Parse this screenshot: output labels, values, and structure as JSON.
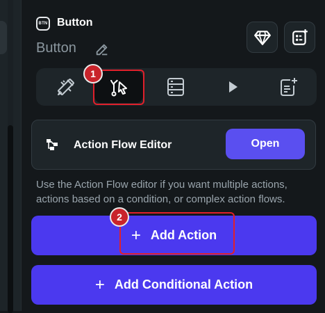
{
  "header": {
    "type_badge": "BTN",
    "type_label": "Button",
    "widget_name": "Button"
  },
  "icons": {
    "edit": "pencil-icon",
    "diamond": "diamond-icon",
    "add_component": "add-component-icon",
    "tabs": [
      "properties-icon",
      "actions-flow-icon",
      "backend-query-icon",
      "animation-play-icon",
      "add-to-list-icon"
    ]
  },
  "tabs": {
    "active_index": 1
  },
  "annotations": {
    "step1": "1",
    "step2": "2",
    "highlight_color": "#e0202b"
  },
  "flow_card": {
    "title": "Action Flow Editor",
    "open_label": "Open"
  },
  "help_text": {
    "line1": "Use the Action Flow editor if you want multiple actions,",
    "line2": "actions based on a condition, or complex action flows."
  },
  "buttons": {
    "add_action": "Add Action",
    "add_conditional_action": "Add Conditional Action",
    "plus": "+"
  },
  "colors": {
    "accent": "#4b39ef",
    "open_button": "#5a4ff0",
    "background": "#14181b",
    "card": "#1e2529"
  }
}
